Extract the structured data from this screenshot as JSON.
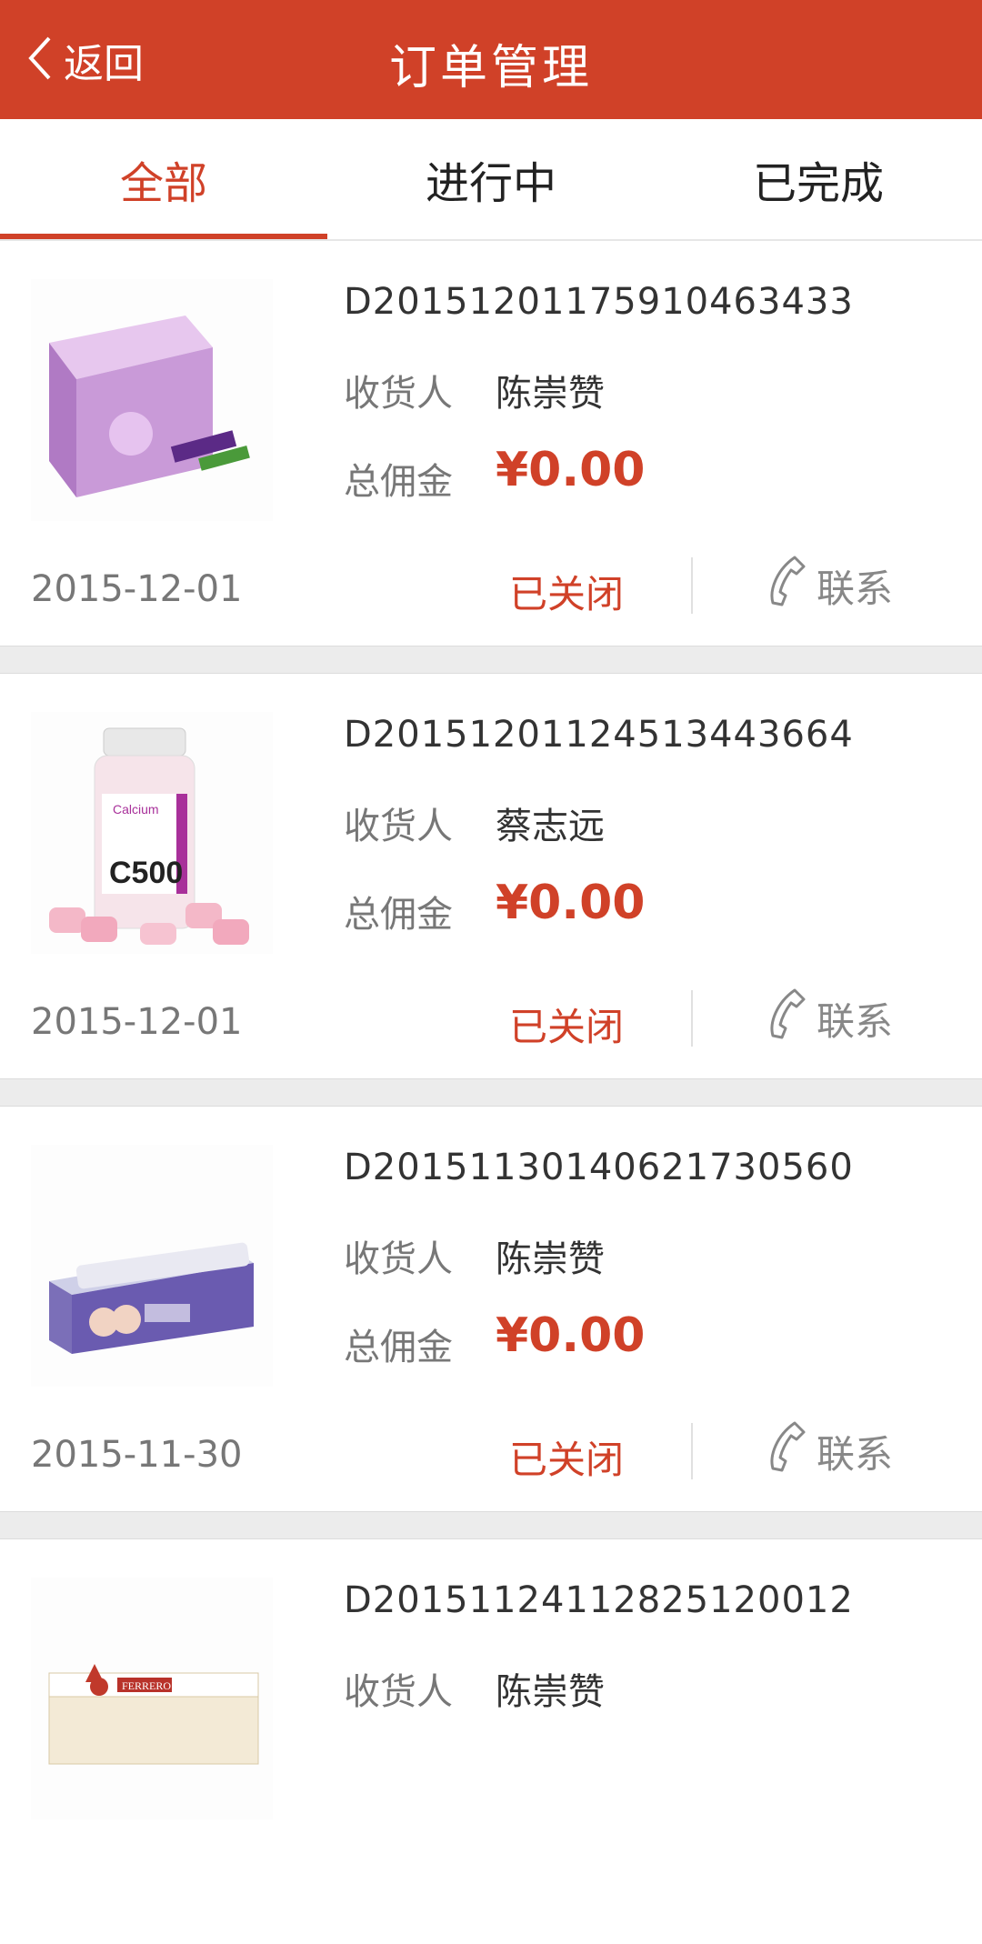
{
  "header": {
    "back_label": "返回",
    "title": "订单管理"
  },
  "tabs": [
    {
      "label": "全部",
      "active": true
    },
    {
      "label": "进行中",
      "active": false
    },
    {
      "label": "已完成",
      "active": false
    }
  ],
  "labels": {
    "receiver": "收货人",
    "commission": "总佣金",
    "contact": "联系"
  },
  "orders": [
    {
      "order_no": "D2015120117591046343З",
      "receiver": "陈崇赞",
      "commission": "¥0.00",
      "date": "2015-12-01",
      "status": "已关闭",
      "product_image": "kids-visionsmart-box"
    },
    {
      "order_no": "D20151201124513443664",
      "receiver": "蔡志远",
      "commission": "¥0.00",
      "date": "2015-12-01",
      "status": "已关闭",
      "product_image": "calcium-c500-bottle"
    },
    {
      "order_no": "D20151130140621730560",
      "receiver": "陈崇赞",
      "commission": "¥0.00",
      "date": "2015-11-30",
      "status": "已关闭",
      "product_image": "toothpaste-box"
    },
    {
      "order_no": "D20151124112825120012",
      "receiver": "陈崇赞",
      "commission": "",
      "date": "",
      "status": "",
      "product_image": "ferrero-box"
    }
  ],
  "colors": {
    "accent": "#d04128",
    "separator": "#ececec"
  }
}
